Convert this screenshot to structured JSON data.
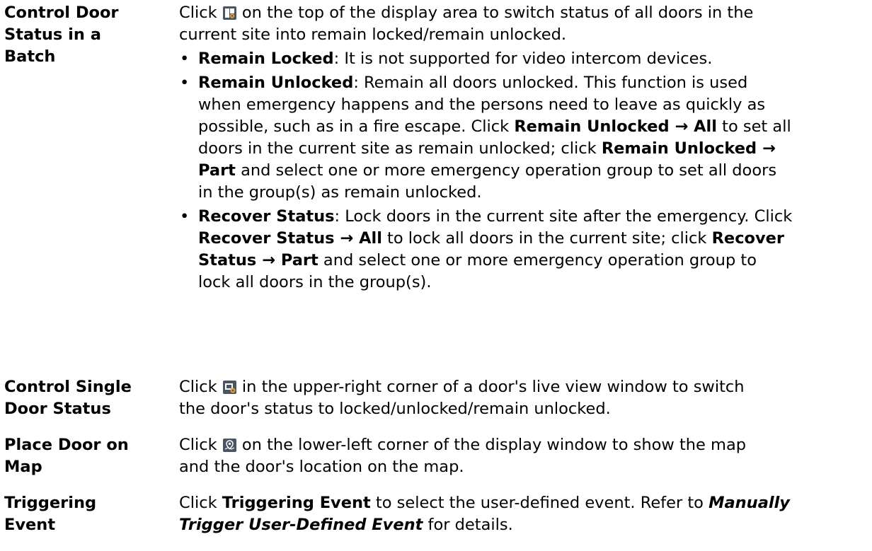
{
  "rows": [
    {
      "label": [
        "Control Door",
        "Status in a",
        "Batch"
      ],
      "intro": {
        "l1_a": "Click ",
        "l1_icon": "door-batch-control-icon",
        "l1_b": " on the top of the display area to switch status of all doors in the",
        "l2": "current site into remain locked/remain unlocked."
      },
      "bullets": {
        "b1": {
          "term": "Remain Locked",
          "text": ": It is not supported for video intercom devices."
        },
        "b2": {
          "term": "Remain Unlocked",
          "l1_text": ": Remain all doors unlocked. This function is used",
          "l2": "when emergency happens and the persons need to leave as quickly as",
          "l3_a": "possible, such as in a fire escape. Click ",
          "l3_bold": "Remain Unlocked → All",
          "l3_b": " to set all",
          "l4_a": "doors in the current site as remain unlocked; click ",
          "l4_bold": "Remain Unlocked →",
          "l5_bold": "Part",
          "l5_b": " and select one or more emergency operation group to set all doors",
          "l6": "in the group(s) as remain unlocked."
        },
        "b3": {
          "term": "Recover Status",
          "l1_text": ": Lock doors in the current site after the emergency. Click",
          "l2_bold": "Recover Status → All",
          "l2_b": " to lock all doors in the current site; click ",
          "l2_bold2": "Recover",
          "l3_bold": "Status → Part",
          "l3_b": " and select one or more emergency operation group to",
          "l4": "lock all doors in the group(s)."
        }
      }
    },
    {
      "label": [
        "Control Single",
        "Door Status"
      ],
      "l1_a": "Click ",
      "l1_icon": "door-status-icon",
      "l1_b": " in the upper-right corner of a door's live view window to switch",
      "l2": "the door's status to locked/unlocked/remain unlocked."
    },
    {
      "label": [
        "Place Door on",
        "Map"
      ],
      "l1_a": "Click ",
      "l1_icon": "map-location-icon",
      "l1_b": " on the lower-left corner of the display window to show the map",
      "l2": "and the door's location on the map."
    },
    {
      "label": [
        "Triggering",
        "Event"
      ],
      "l1_a": "Click ",
      "l1_bold": "Triggering Event",
      "l1_b": " to select the user-defined event. Refer to ",
      "l1_bi": "Manually",
      "l2_bi": "Trigger User-Defined Event",
      "l2_b": " for details."
    }
  ],
  "colors": {
    "text": "#000000",
    "icon_bg": "#4a5563",
    "icon_accent": "#e0a030"
  }
}
